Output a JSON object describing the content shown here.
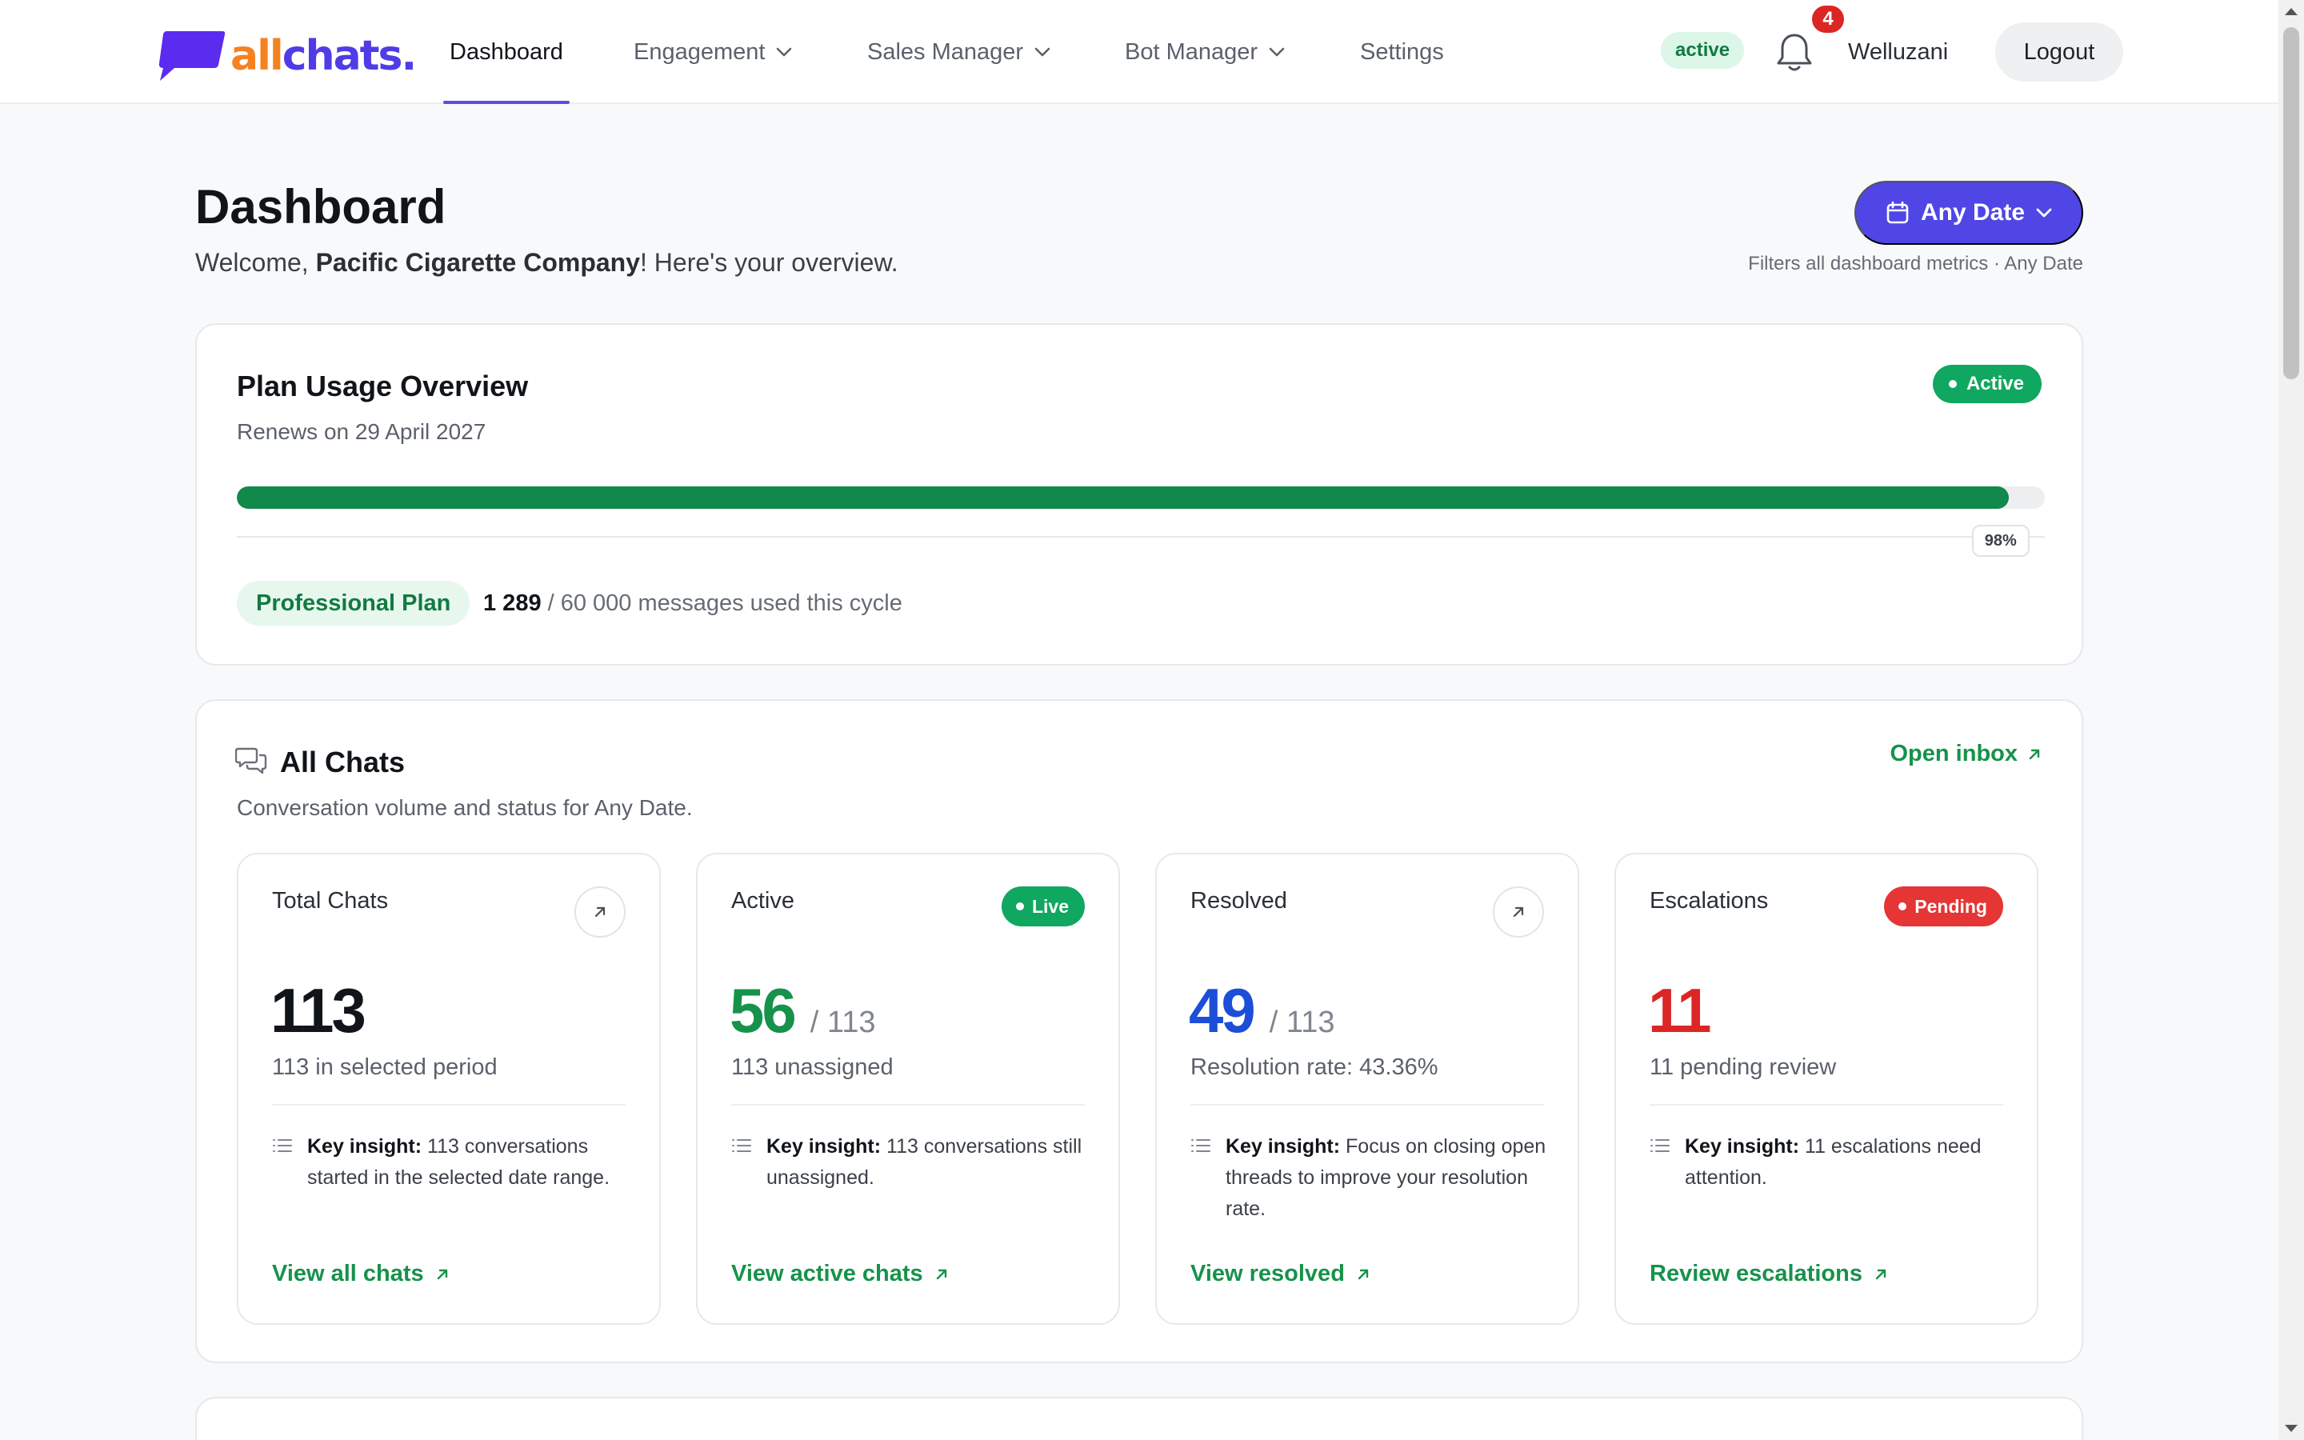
{
  "nav": {
    "logo_part1": "all",
    "logo_part2": "chats.",
    "items": [
      {
        "label": "Dashboard",
        "active": true,
        "has_dropdown": false
      },
      {
        "label": "Engagement",
        "active": false,
        "has_dropdown": true
      },
      {
        "label": "Sales Manager",
        "active": false,
        "has_dropdown": true
      },
      {
        "label": "Bot Manager",
        "active": false,
        "has_dropdown": true
      },
      {
        "label": "Settings",
        "active": false,
        "has_dropdown": false
      }
    ],
    "status": "active",
    "notification_count": "4",
    "user_name": "Welluzani",
    "logout_label": "Logout"
  },
  "header": {
    "title": "Dashboard",
    "welcome_prefix": "Welcome, ",
    "company": "Pacific Cigarette Company",
    "welcome_suffix": "! Here's your overview.",
    "date_filter_label": "Any Date",
    "date_filter_note": "Filters all dashboard metrics · Any Date"
  },
  "plan": {
    "title": "Plan Usage Overview",
    "renews": "Renews on 29 April 2027",
    "status": "Active",
    "progress_percent": 98,
    "progress_label": "98%",
    "plan_name": "Professional Plan",
    "used": "1 289",
    "usage_suffix": "/ 60 000 messages used this cycle"
  },
  "chats": {
    "title": "All Chats",
    "subtitle": "Conversation volume and status for Any Date.",
    "open_inbox": "Open inbox",
    "stats": [
      {
        "label": "Total Chats",
        "value": "113",
        "total": "",
        "subtext": "113 in selected period",
        "insight_label": "Key insight:",
        "insight": " 113 conversations started in the selected date range.",
        "link": "View all chats",
        "color": "#111418",
        "badge": "",
        "badge_type": ""
      },
      {
        "label": "Active",
        "value": "56",
        "total": "/ 113",
        "subtext": "113 unassigned",
        "insight_label": "Key insight:",
        "insight": " 113 conversations still unassigned.",
        "link": "View active chats",
        "color": "#16924b",
        "badge": "Live",
        "badge_type": "live"
      },
      {
        "label": "Resolved",
        "value": "49",
        "total": "/ 113",
        "subtext": "Resolution rate: 43.36%",
        "insight_label": "Key insight:",
        "insight": " Focus on closing open threads to improve your resolution rate.",
        "link": "View resolved",
        "color": "#1d4ed8",
        "badge": "",
        "badge_type": ""
      },
      {
        "label": "Escalations",
        "value": "11",
        "total": "",
        "subtext": "11 pending review",
        "insight_label": "Key insight:",
        "insight": " 11 escalations need attention.",
        "link": "Review escalations",
        "color": "#dc2626",
        "badge": "Pending",
        "badge_type": "pending"
      }
    ]
  },
  "colors": {
    "accent": "#4f46e5",
    "success": "#10a760",
    "link_green": "#16924b",
    "danger": "#dc2626",
    "logo_orange": "#f58220",
    "logo_purple": "#4f3ce6"
  },
  "icons": {
    "logo": "speech-bubble-logo",
    "bell": "bell-icon",
    "calendar": "calendar-icon",
    "chats": "chat-bubbles-icon",
    "external": "arrow-up-right-icon",
    "insight": "list-icon"
  }
}
